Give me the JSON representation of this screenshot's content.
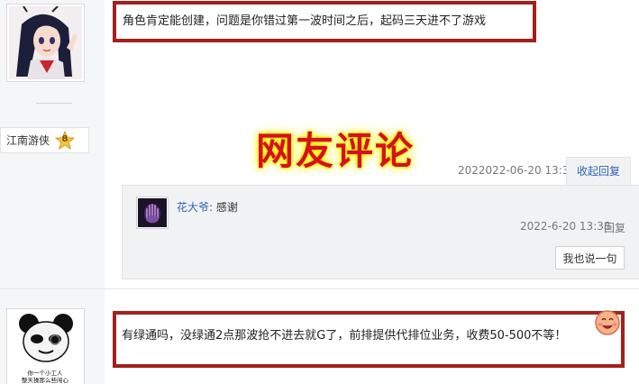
{
  "posts": [
    {
      "avatar_icon": "anime-girl-avatar",
      "username": "江南游侠",
      "level": "8",
      "comment": "角色肯定能创建，问题是你错过第一波时间之后，起码三天进不了游戏",
      "meta": "2022022-06-20 13:36",
      "collapse_label": "收起回复",
      "reply": {
        "user": "花大爷:",
        "text": " 感谢",
        "time": "2022-6-20 13:38",
        "reply_label": "回复",
        "say_button": "我也说一句"
      }
    },
    {
      "avatar_icon": "panda-meme-avatar",
      "avatar_caption_1": "你一个小工人",
      "avatar_caption_2": "整天操那么些闲心",
      "comment": "有绿通吗，没绿通2点那波抢不进去就G了，前排提供代排位业务，收费50-500不等！",
      "emoji_icon": "smiley-face-icon"
    }
  ],
  "overlay": {
    "title": "网友评论"
  },
  "colors": {
    "highlight_border": "#a3201d",
    "overlay_text": "#d5121c",
    "overlay_glow": "#fff200",
    "link": "#2d64b3"
  }
}
